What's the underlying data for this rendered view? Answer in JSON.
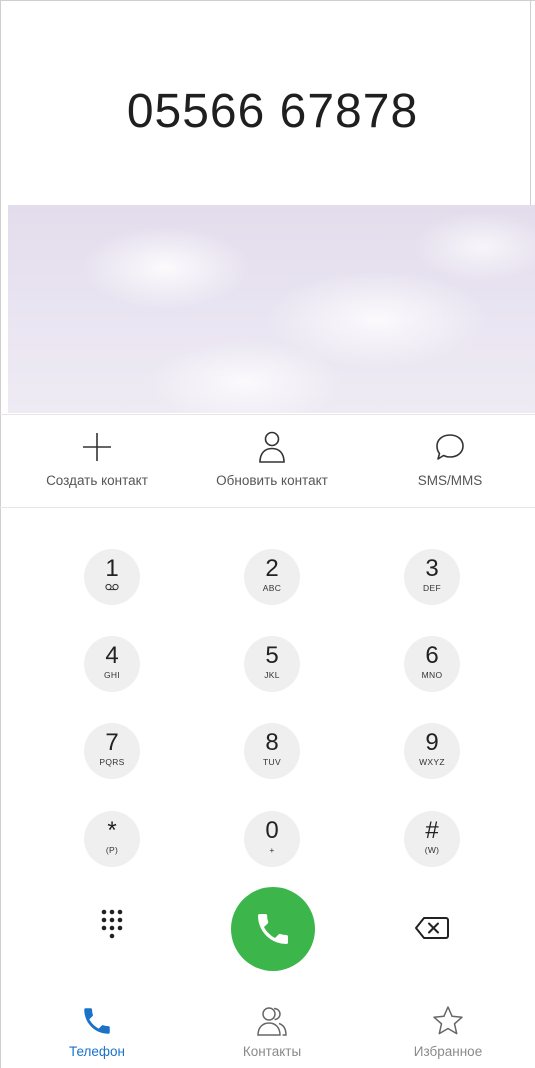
{
  "display": {
    "number": "05566 67878"
  },
  "actions": [
    {
      "label": "Создать контакт",
      "icon": "plus-icon"
    },
    {
      "label": "Обновить контакт",
      "icon": "person-icon"
    },
    {
      "label": "SMS/MMS",
      "icon": "chat-bubble-icon"
    }
  ],
  "keypad": {
    "keys": [
      {
        "digit": "1",
        "letters": "",
        "icon": "voicemail-icon"
      },
      {
        "digit": "2",
        "letters": "ABC"
      },
      {
        "digit": "3",
        "letters": "DEF"
      },
      {
        "digit": "4",
        "letters": "GHI"
      },
      {
        "digit": "5",
        "letters": "JKL"
      },
      {
        "digit": "6",
        "letters": "MNO"
      },
      {
        "digit": "7",
        "letters": "PQRS"
      },
      {
        "digit": "8",
        "letters": "TUV"
      },
      {
        "digit": "9",
        "letters": "WXYZ"
      },
      {
        "digit": "*",
        "letters": "(P)"
      },
      {
        "digit": "0",
        "letters": "+"
      },
      {
        "digit": "#",
        "letters": "(W)"
      }
    ]
  },
  "controls": {
    "dialpad_icon": "dialpad-grid-icon",
    "call_icon": "phone-icon",
    "backspace_icon": "backspace-icon",
    "call_color": "#3cb64a"
  },
  "nav": {
    "items": [
      {
        "label": "Телефон",
        "icon": "phone-icon",
        "active": true
      },
      {
        "label": "Контакты",
        "icon": "contacts-icon",
        "active": false
      },
      {
        "label": "Избранное",
        "icon": "star-icon",
        "active": false
      }
    ],
    "active_color": "#1a73c9",
    "inactive_color": "#8a8a8a"
  }
}
